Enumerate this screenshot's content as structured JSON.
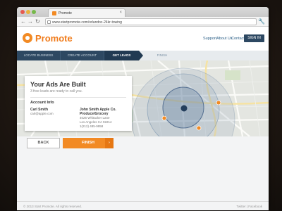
{
  "browser": {
    "tab_title": "Promote",
    "url": "www.startpromote.com/orlandoc-24kr-towing",
    "close_glyph": "×"
  },
  "header": {
    "logo_text": "Promote",
    "links": [
      "Support",
      "About Us",
      "Contact"
    ],
    "signin_label": "SIGN IN"
  },
  "steps": [
    {
      "label": "Locate Business"
    },
    {
      "label": "Create Account"
    },
    {
      "label": "Get Leads"
    },
    {
      "label": "Finish"
    }
  ],
  "card": {
    "title": "Your Ads Are Built",
    "subtitle": "3 free leads are ready to call you.",
    "section_title": "Account Info",
    "user_name": "Carl Smith",
    "user_email": "carl@apple.com",
    "business_name": "John Smith Apple Co.",
    "business_category": "Produce/Grocery",
    "address_line1": "4026 Whitacker Lane",
    "address_line2": "Los Angeles CA 92214",
    "phone": "1(212) 485-9958"
  },
  "actions": {
    "back_label": "BACK",
    "finish_label": "FINISH",
    "finish_caret": "›"
  },
  "footer": {
    "copyright": "© 2013 Start Promote. All rights reserved.",
    "social": "Twitter  |  Facebook"
  },
  "colors": {
    "accent": "#f28a24",
    "navy": "#2d4862",
    "link": "#2b5f87"
  }
}
